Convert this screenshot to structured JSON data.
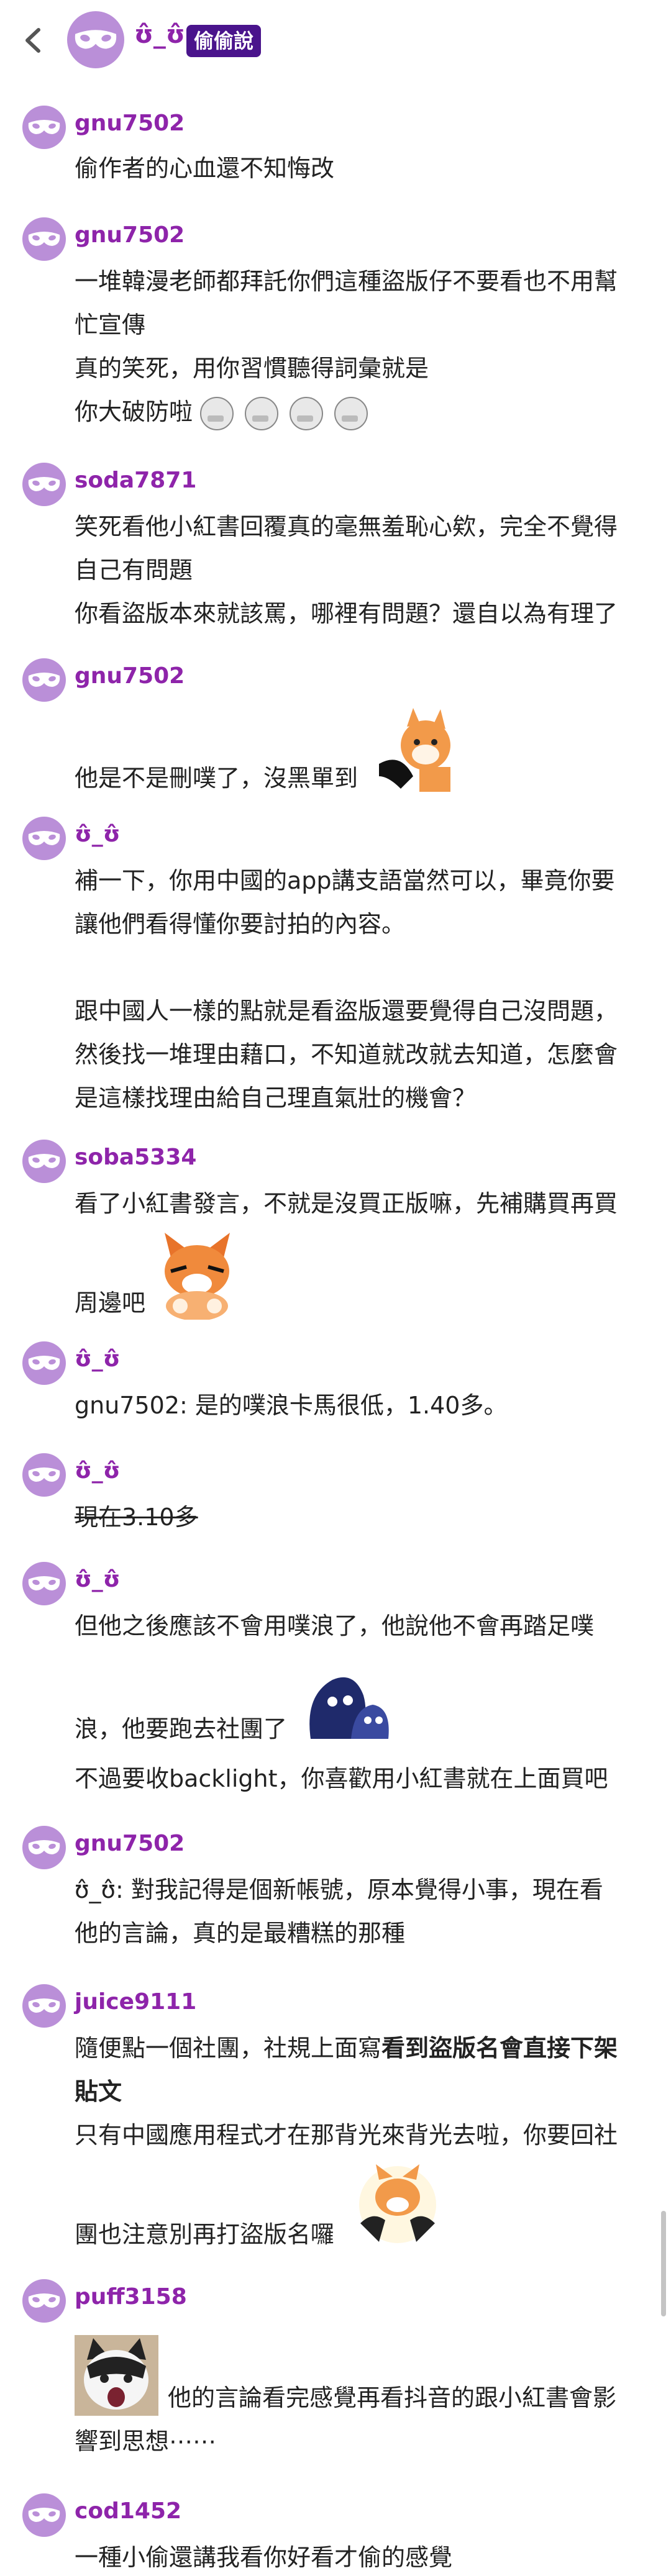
{
  "header": {
    "username": "ʊ̂_ʊ̂",
    "badge": "偷偷說"
  },
  "comments": [
    {
      "user": "gnu7502",
      "lines": [
        "偷作者的心血還不知悔改"
      ]
    },
    {
      "user": "gnu7502",
      "lines": [
        "一堆韓漫老師都拜託你們這種盜版仔不要看也不用幫",
        "忙宣傳",
        "真的笑死，用你習慣聽得詞彙就是",
        "你大破防啦"
      ]
    },
    {
      "user": "soda7871",
      "lines": [
        "笑死看他小紅書回覆真的毫無羞恥心欸，完全不覺得",
        "自己有問題",
        "你看盜版本來就該罵，哪裡有問題？還自以為有理了"
      ]
    },
    {
      "user": "gnu7502",
      "lines": [
        "他是不是刪噗了，沒黑單到"
      ]
    },
    {
      "user": "ʊ̂_ʊ̂",
      "lines": [
        "補一下，你用中國的app講支語當然可以，畢竟你要",
        "讓他們看得懂你要討拍的內容。",
        "跟中國人一樣的點就是看盜版還要覺得自己沒問題，",
        "然後找一堆理由藉口，不知道就改就去知道，怎麼會",
        "是這樣找理由給自己理直氣壯的機會？"
      ]
    },
    {
      "user": "soba5334",
      "lines": [
        "看了小紅書發言，不就是沒買正版嘛，先補購買再買",
        "周邊吧"
      ]
    },
    {
      "user": "ʊ̂_ʊ̂",
      "lines": [
        "gnu7502: 是的噗浪卡馬很低，1.40多。"
      ]
    },
    {
      "user": "ʊ̂_ʊ̂",
      "lines": [
        "現在3.10多"
      ]
    },
    {
      "user": "ʊ̂_ʊ̂",
      "lines": [
        "但他之後應該不會用噗浪了，他說他不會再踏足噗",
        "浪，他要跑去社團了",
        "不過要收backlight，你喜歡用小紅書就在上面買吧"
      ]
    },
    {
      "user": "gnu7502",
      "lines": [
        "ʊ̂_ʊ̂: 對我記得是個新帳號，原本覺得小事，現在看",
        "他的言論，真的是最糟糕的那種"
      ]
    },
    {
      "user": "juice9111",
      "lines": [
        "隨便點一個社團，社規上面寫",
        "看到盜版名會直接下架",
        "貼文",
        "只有中國應用程式才在那背光來背光去啦，你要回社",
        "團也注意別再打盜版名囉"
      ]
    },
    {
      "user": "puff3158",
      "lines": [
        "他的言論看完感覺再看抖音的跟小紅書會影",
        "響到思想⋯⋯"
      ]
    },
    {
      "user": "cod1452",
      "lines": [
        "一種小偷還講我看你好看才偷的感覺"
      ]
    }
  ]
}
